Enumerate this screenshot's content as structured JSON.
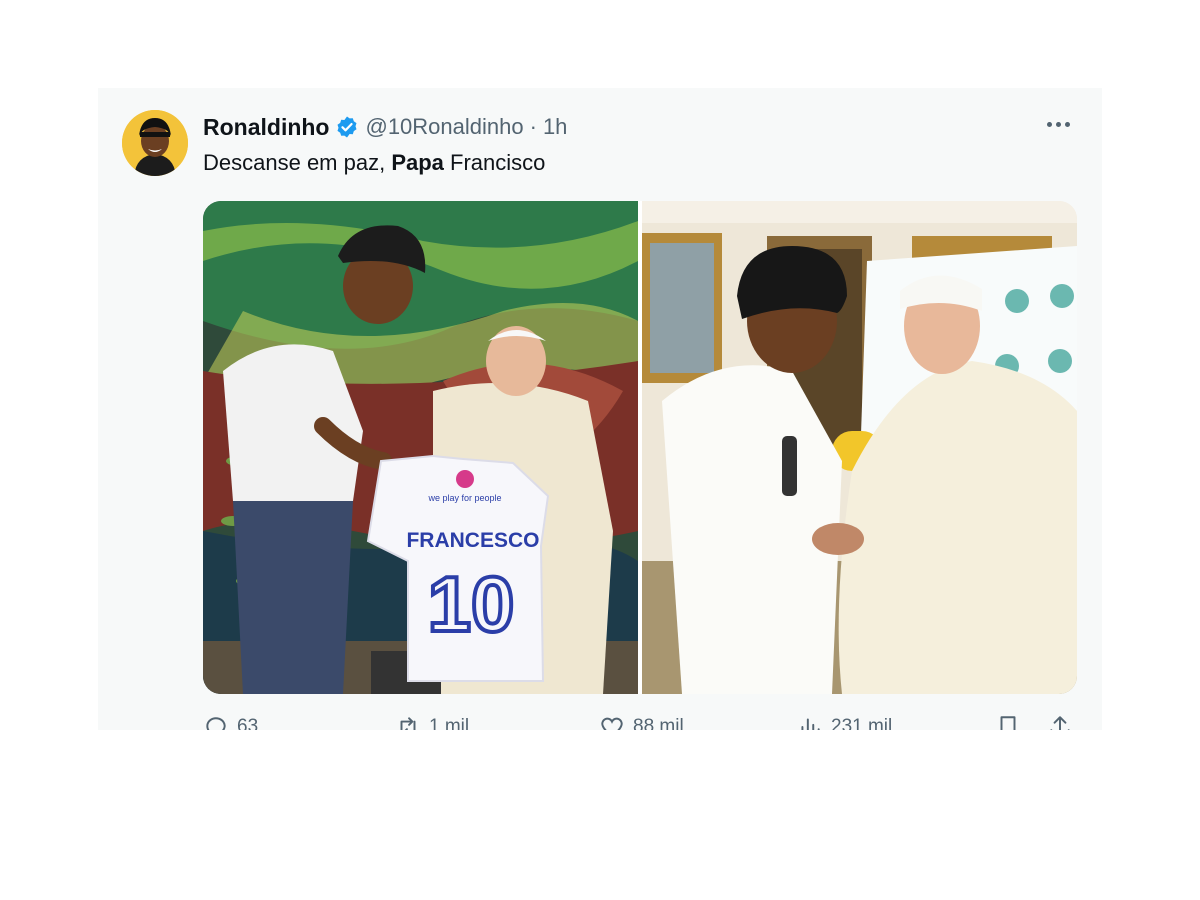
{
  "tweet": {
    "author_name": "Ronaldinho",
    "handle": "@10Ronaldinho",
    "separator": "·",
    "time": "1h",
    "text_pre": "Descanse em paz, ",
    "text_bold": "Papa",
    "text_post": " Francisco"
  },
  "media": {
    "jersey_brand": "we play for people",
    "jersey_name": "FRANCESCO",
    "jersey_number": "10"
  },
  "actions": {
    "replies": "63",
    "reposts": "1 mil",
    "likes": "88 mil",
    "views": "231 mil"
  },
  "colors": {
    "verified": "#1d9bf0",
    "secondary_text": "#536471",
    "card_bg": "#f7f9f9"
  }
}
